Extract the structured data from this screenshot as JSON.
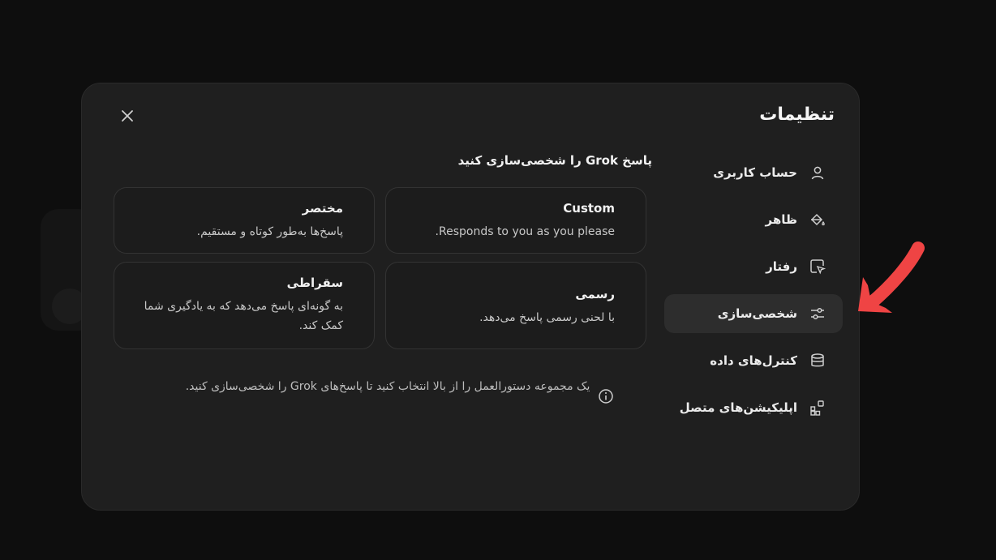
{
  "modal": {
    "title": "تنظیمات",
    "section_title": "پاسخ Grok را شخصی‌سازی کنید"
  },
  "sidebar": {
    "items": [
      {
        "label": "حساب کاربری",
        "icon": "user-icon"
      },
      {
        "label": "ظاهر",
        "icon": "paint-bucket-icon"
      },
      {
        "label": "رفتار",
        "icon": "cursor-icon"
      },
      {
        "label": "شخصی‌سازی",
        "icon": "sliders-icon",
        "active": true
      },
      {
        "label": "کنترل‌های داده",
        "icon": "database-icon"
      },
      {
        "label": "اپلیکیشن‌های متصل",
        "icon": "apps-icon"
      }
    ]
  },
  "cards": [
    {
      "title": "Custom",
      "desc": "Responds to you as you please."
    },
    {
      "title": "مختصر",
      "desc": "پاسخ‌ها به‌طور کوتاه و مستقیم."
    },
    {
      "title": "رسمی",
      "desc": "با لحنی رسمی پاسخ می‌دهد."
    },
    {
      "title": "سقراطی",
      "desc": "به گونه‌ای پاسخ می‌دهد که به یادگیری شما کمک کند."
    }
  ],
  "info": {
    "text": "یک مجموعه دستورالعمل را از بالا انتخاب کنید تا پاسخ‌های Grok را شخصی‌سازی کنید."
  },
  "colors": {
    "modal_bg": "#1f1f1f",
    "active_item_bg": "#2d2d2d",
    "arrow": "#ef4444"
  }
}
